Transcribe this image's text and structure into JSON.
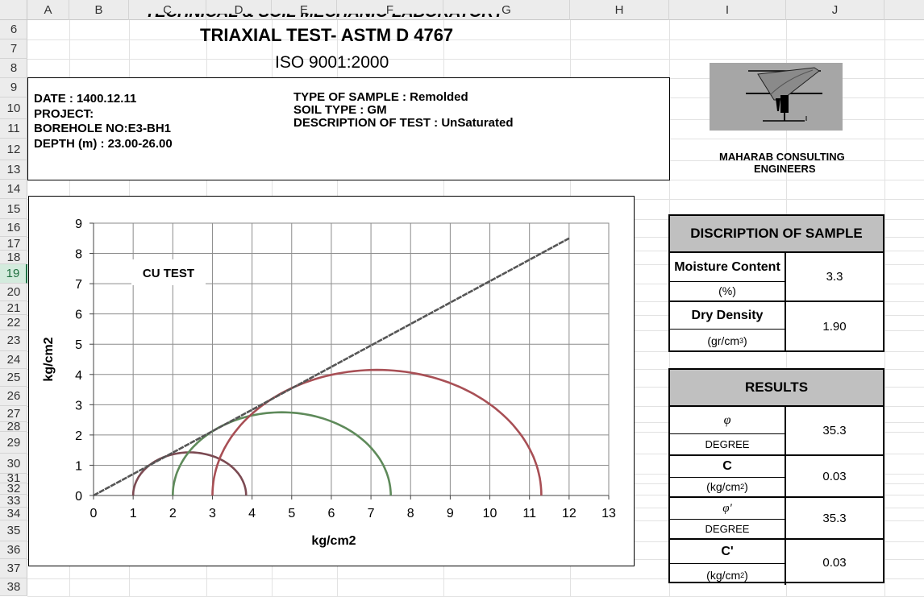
{
  "spreadsheet": {
    "columns": [
      {
        "label": "A"
      },
      {
        "label": "B"
      },
      {
        "label": "C"
      },
      {
        "label": "D"
      },
      {
        "label": "E"
      },
      {
        "label": "F"
      },
      {
        "label": "G"
      },
      {
        "label": "H"
      },
      {
        "label": "I"
      },
      {
        "label": "J"
      }
    ],
    "rows": [
      "6",
      "7",
      "8",
      "9",
      "10",
      "11",
      "12",
      "13",
      "14",
      "15",
      "16",
      "17",
      "18",
      "19",
      "20",
      "21",
      "22",
      "23",
      "24",
      "25",
      "26",
      "27",
      "28",
      "29",
      "30",
      "31",
      "32",
      "33",
      "34",
      "35",
      "36",
      "37",
      "38"
    ],
    "selected_row": "19"
  },
  "header": {
    "lab_title": "TECHNICAL & SOIL MECHANIC LABORATORY",
    "test_title": "TRIAXIAL TEST- ASTM D 4767",
    "iso": "ISO 9001:2000"
  },
  "info": {
    "date": "DATE : 1400.12.11",
    "project": "PROJECT:",
    "borehole": "BOREHOLE NO:E3-BH1",
    "depth": "DEPTH (m) : 23.00-26.00",
    "sample_type": "TYPE OF SAMPLE : Remolded",
    "soil_type": "SOIL TYPE : GM",
    "test_description": "DESCRIPTION OF TEST : UnSaturated"
  },
  "company": {
    "name_line1": "MAHARAB CONSULTING",
    "name_line2": "ENGINEERS"
  },
  "chart_data": {
    "type": "line",
    "annotation": "CU TEST",
    "xlabel": "kg/cm2",
    "ylabel": "kg/cm2",
    "xlim": [
      0,
      13
    ],
    "ylim": [
      0,
      9
    ],
    "xticks": [
      "0",
      "1",
      "2",
      "3",
      "4",
      "5",
      "6",
      "7",
      "8",
      "9",
      "10",
      "11",
      "12",
      "13"
    ],
    "yticks": [
      "0",
      "1",
      "2",
      "3",
      "4",
      "5",
      "6",
      "7",
      "8",
      "9"
    ],
    "grid": true,
    "envelope": {
      "color": "#555555",
      "x": [
        0,
        12
      ],
      "y": [
        0,
        8.5
      ]
    },
    "mohr_circles": [
      {
        "sigma3": 1.0,
        "sigma1": 3.85,
        "color": "#7b4a52"
      },
      {
        "sigma3": 2.0,
        "sigma1": 7.5,
        "color": "#5e8a5a"
      },
      {
        "sigma3": 3.0,
        "sigma1": 11.3,
        "color": "#a84f55"
      }
    ]
  },
  "sample_table": {
    "title": "DISCRIPTION OF SAMPLE",
    "moisture_label": "Moisture Content",
    "moisture_unit": "(%)",
    "moisture_value": "3.3",
    "density_label": "Dry Density",
    "density_unit": "(gr/cm",
    "density_unit_sup": "3",
    "density_unit_end": ")",
    "density_value": "1.90"
  },
  "results_table": {
    "title": "RESULTS",
    "phi_symbol": "φ",
    "phi_unit": "DEGREE",
    "phi_value": "35.3",
    "c_label": "C",
    "c_unit": "(kg/cm",
    "c_unit_sup": "2",
    "c_unit_end": ")",
    "c_value": "0.03",
    "phi_eff_symbol": "φ'",
    "phi_eff_unit": "DEGREE",
    "phi_eff_value": "35.3",
    "c_eff_label": "C'",
    "c_eff_unit": "(kg/cm",
    "c_eff_unit_sup": "2",
    "c_eff_unit_end": ")",
    "c_eff_value": "0.03"
  }
}
